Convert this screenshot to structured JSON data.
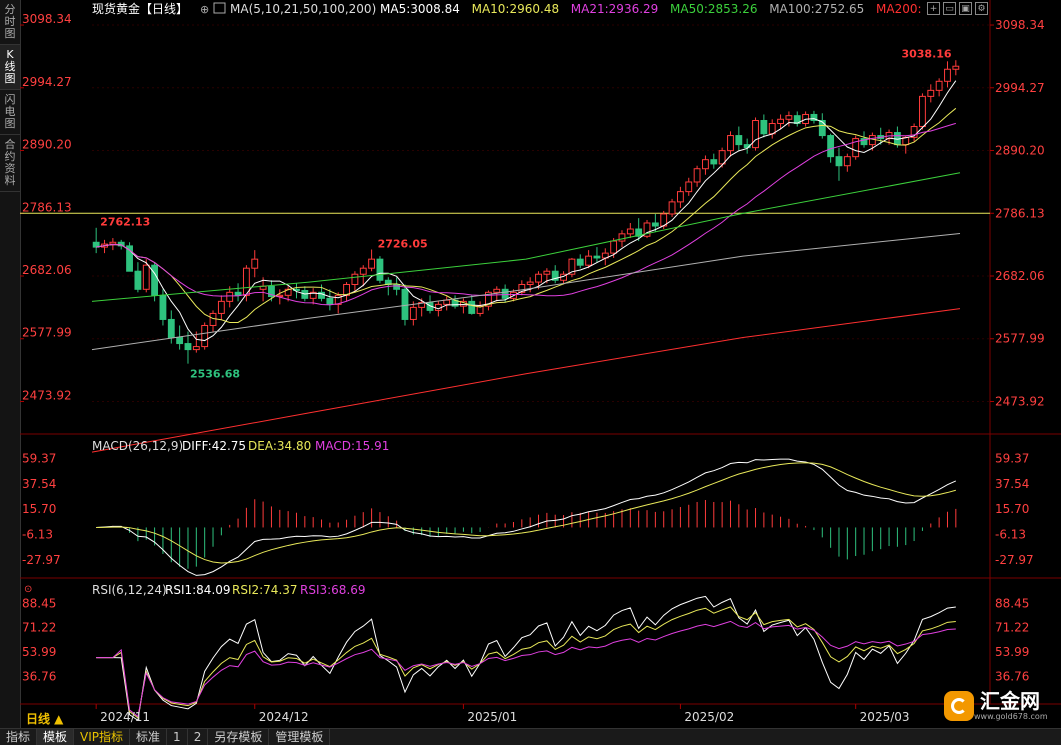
{
  "sidebar": [
    "分时图",
    "K线图",
    "闪电图",
    "合约资料"
  ],
  "sidebar_active": 1,
  "header": {
    "title": "现货黄金【日线】",
    "ma_label": "MA(5,10,21,50,100,200)",
    "ma_values": [
      {
        "text": "MA5:3008.84",
        "color": "#ffffff"
      },
      {
        "text": "MA10:2960.48",
        "color": "#e8e85a"
      },
      {
        "text": "MA21:2936.29",
        "color": "#e040e0"
      },
      {
        "text": "MA50:2853.26",
        "color": "#3cd03c"
      },
      {
        "text": "MA100:2752.65",
        "color": "#b0b0b0"
      },
      {
        "text": "MA200:",
        "color": "#ff3030"
      }
    ]
  },
  "price_axis": [
    "3098.34",
    "2994.27",
    "2890.20",
    "2786.13",
    "2682.06",
    "2577.99",
    "2473.92"
  ],
  "annotations": [
    "3038.16",
    "2762.13",
    "2726.05",
    "2536.68"
  ],
  "macd": {
    "label": "MACD(26,12,9)",
    "diff": "DIFF:42.75",
    "dea": "DEA:34.80",
    "macd": "MACD:15.91",
    "axis": [
      "59.37",
      "37.54",
      "15.70",
      "-6.13",
      "-27.97"
    ]
  },
  "rsi": {
    "label": "RSI(6,12,24)",
    "rsi1": "RSI1:84.09",
    "rsi2": "RSI2:74.37",
    "rsi3": "RSI3:68.69",
    "axis": [
      "88.45",
      "71.22",
      "53.99",
      "36.76"
    ]
  },
  "time_axis": [
    "2024/11",
    "2024/12",
    "2025/01",
    "2025/02",
    "2025/03"
  ],
  "period_label": "日线 ▲",
  "bottom_tabs": [
    "指标",
    "模板",
    "VIP指标",
    "标准",
    "1",
    "2",
    "另存模板",
    "管理模板"
  ],
  "logo": {
    "name": "汇金网",
    "url": "www.gold678.com"
  },
  "colors": {
    "up": "#ff3b3b",
    "down": "#2ec27e",
    "bg": "#000000",
    "grid": "#3a0000"
  },
  "chart_data": {
    "type": "candlestick",
    "ohlc": [
      [
        2738,
        2762,
        2720,
        2730
      ],
      [
        2730,
        2742,
        2720,
        2735
      ],
      [
        2735,
        2745,
        2725,
        2738
      ],
      [
        2738,
        2742,
        2726,
        2732
      ],
      [
        2732,
        2738,
        2700,
        2690
      ],
      [
        2690,
        2705,
        2655,
        2660
      ],
      [
        2660,
        2710,
        2655,
        2700
      ],
      [
        2700,
        2705,
        2640,
        2650
      ],
      [
        2650,
        2660,
        2600,
        2610
      ],
      [
        2610,
        2625,
        2570,
        2580
      ],
      [
        2580,
        2600,
        2560,
        2570
      ],
      [
        2570,
        2590,
        2536.68,
        2560
      ],
      [
        2560,
        2590,
        2555,
        2565
      ],
      [
        2565,
        2605,
        2560,
        2600
      ],
      [
        2600,
        2625,
        2590,
        2620
      ],
      [
        2620,
        2650,
        2610,
        2640
      ],
      [
        2640,
        2665,
        2630,
        2655
      ],
      [
        2655,
        2670,
        2640,
        2650
      ],
      [
        2650,
        2700,
        2640,
        2695
      ],
      [
        2695,
        2725,
        2680,
        2710
      ],
      [
        2660,
        2680,
        2640,
        2665
      ],
      [
        2665,
        2675,
        2640,
        2648
      ],
      [
        2648,
        2660,
        2635,
        2650
      ],
      [
        2650,
        2665,
        2640,
        2660
      ],
      [
        2660,
        2670,
        2645,
        2658
      ],
      [
        2658,
        2665,
        2640,
        2645
      ],
      [
        2645,
        2662,
        2635,
        2655
      ],
      [
        2655,
        2668,
        2640,
        2645
      ],
      [
        2645,
        2660,
        2625,
        2635
      ],
      [
        2635,
        2655,
        2620,
        2650
      ],
      [
        2650,
        2672,
        2640,
        2668
      ],
      [
        2668,
        2690,
        2655,
        2685
      ],
      [
        2685,
        2700,
        2665,
        2695
      ],
      [
        2695,
        2726.05,
        2690,
        2710
      ],
      [
        2710,
        2715,
        2670,
        2675
      ],
      [
        2675,
        2680,
        2650,
        2668
      ],
      [
        2668,
        2680,
        2650,
        2660
      ],
      [
        2660,
        2668,
        2600,
        2610
      ],
      [
        2610,
        2640,
        2600,
        2630
      ],
      [
        2630,
        2645,
        2615,
        2638
      ],
      [
        2638,
        2650,
        2620,
        2625
      ],
      [
        2625,
        2640,
        2615,
        2635
      ],
      [
        2635,
        2648,
        2625,
        2642
      ],
      [
        2642,
        2650,
        2628,
        2632
      ],
      [
        2632,
        2645,
        2620,
        2640
      ],
      [
        2640,
        2650,
        2618,
        2620
      ],
      [
        2620,
        2640,
        2615,
        2632
      ],
      [
        2632,
        2658,
        2625,
        2655
      ],
      [
        2655,
        2665,
        2640,
        2660
      ],
      [
        2660,
        2668,
        2638,
        2645
      ],
      [
        2645,
        2660,
        2640,
        2655
      ],
      [
        2655,
        2675,
        2650,
        2668
      ],
      [
        2668,
        2680,
        2655,
        2672
      ],
      [
        2672,
        2690,
        2660,
        2685
      ],
      [
        2685,
        2695,
        2670,
        2690
      ],
      [
        2690,
        2700,
        2670,
        2675
      ],
      [
        2675,
        2690,
        2668,
        2685
      ],
      [
        2685,
        2712,
        2680,
        2710
      ],
      [
        2710,
        2718,
        2695,
        2700
      ],
      [
        2700,
        2725,
        2695,
        2715
      ],
      [
        2715,
        2730,
        2705,
        2712
      ],
      [
        2712,
        2728,
        2700,
        2720
      ],
      [
        2720,
        2745,
        2712,
        2740
      ],
      [
        2740,
        2758,
        2730,
        2752
      ],
      [
        2752,
        2770,
        2745,
        2760
      ],
      [
        2760,
        2778,
        2740,
        2748
      ],
      [
        2748,
        2775,
        2745,
        2770
      ],
      [
        2770,
        2785,
        2755,
        2765
      ],
      [
        2765,
        2790,
        2760,
        2785
      ],
      [
        2785,
        2810,
        2780,
        2805
      ],
      [
        2805,
        2830,
        2795,
        2822
      ],
      [
        2822,
        2845,
        2815,
        2838
      ],
      [
        2838,
        2865,
        2830,
        2860
      ],
      [
        2860,
        2882,
        2850,
        2875
      ],
      [
        2875,
        2885,
        2860,
        2868
      ],
      [
        2868,
        2895,
        2862,
        2890
      ],
      [
        2890,
        2922,
        2880,
        2915
      ],
      [
        2915,
        2930,
        2890,
        2900
      ],
      [
        2900,
        2910,
        2885,
        2895
      ],
      [
        2895,
        2945,
        2890,
        2940
      ],
      [
        2940,
        2950,
        2912,
        2918
      ],
      [
        2918,
        2942,
        2910,
        2935
      ],
      [
        2935,
        2950,
        2925,
        2942
      ],
      [
        2942,
        2955,
        2930,
        2948
      ],
      [
        2948,
        2955,
        2930,
        2935
      ],
      [
        2935,
        2955,
        2930,
        2950
      ],
      [
        2950,
        2956,
        2935,
        2940
      ],
      [
        2940,
        2952,
        2910,
        2915
      ],
      [
        2915,
        2918,
        2870,
        2880
      ],
      [
        2880,
        2895,
        2840,
        2865
      ],
      [
        2865,
        2885,
        2855,
        2880
      ],
      [
        2880,
        2915,
        2875,
        2910
      ],
      [
        2910,
        2922,
        2895,
        2900
      ],
      [
        2900,
        2920,
        2890,
        2915
      ],
      [
        2915,
        2928,
        2900,
        2910
      ],
      [
        2910,
        2925,
        2900,
        2920
      ],
      [
        2920,
        2930,
        2895,
        2900
      ],
      [
        2900,
        2915,
        2885,
        2912
      ],
      [
        2912,
        2935,
        2905,
        2930
      ],
      [
        2930,
        2985,
        2925,
        2980
      ],
      [
        2980,
        3000,
        2970,
        2990
      ],
      [
        2990,
        3010,
        2980,
        3005
      ],
      [
        3005,
        3038.16,
        2995,
        3025
      ],
      [
        3025,
        3040,
        3015,
        3030
      ]
    ],
    "ma5_last": 3008.84,
    "ma10_last": 2960.48,
    "ma21_last": 2936.29,
    "ma50": [
      2640,
      2672,
      2710,
      2786,
      2853.26
    ],
    "ma100": [
      2560,
      2612,
      2660,
      2715,
      2752.65
    ],
    "ma200": [
      2390,
      2455,
      2520,
      2580,
      2628
    ],
    "reference_level": 2786.13,
    "ylim": [
      2420,
      3110
    ],
    "macd_ylim": [
      -40,
      70
    ],
    "rsi_ylim": [
      20,
      95
    ]
  }
}
